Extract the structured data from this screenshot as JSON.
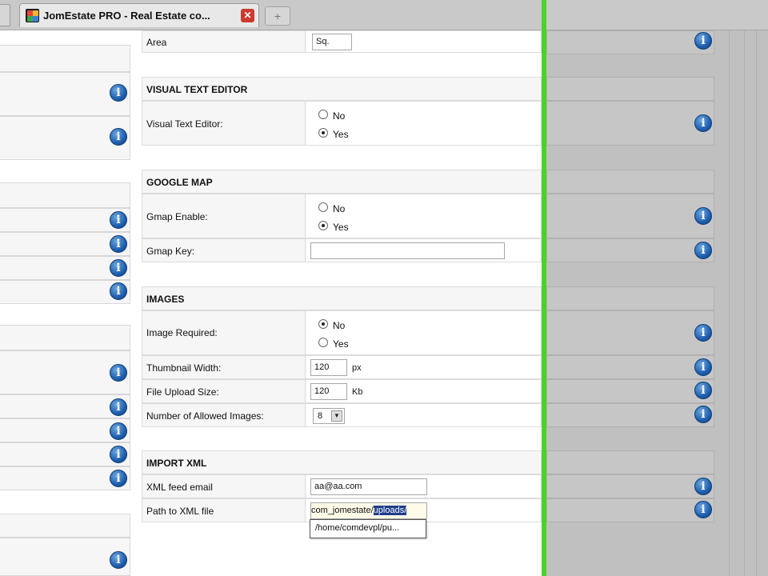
{
  "browser": {
    "tab_title": "JomEstate PRO - Real Estate co...",
    "close_symbol": "✕",
    "new_tab_symbol": "+"
  },
  "form": {
    "area": {
      "label": "Area",
      "value": "Sq."
    },
    "visual_editor": {
      "section": "VISUAL TEXT EDITOR",
      "label": "Visual Text Editor:",
      "options": [
        "No",
        "Yes"
      ],
      "selected": "Yes"
    },
    "google_map": {
      "section": "GOOGLE MAP",
      "enable_label": "Gmap Enable:",
      "options": [
        "No",
        "Yes"
      ],
      "selected": "Yes",
      "key_label": "Gmap Key:",
      "key_value": ""
    },
    "images": {
      "section": "IMAGES",
      "required_label": "Image Required:",
      "options": [
        "No",
        "Yes"
      ],
      "selected": "No",
      "thumb_label": "Thumbnail Width:",
      "thumb_value": "120",
      "thumb_unit": "px",
      "upload_label": "File Upload Size:",
      "upload_value": "120",
      "upload_unit": "Kb",
      "allowed_label": "Number of Allowed Images:",
      "allowed_value": "8"
    },
    "import_xml": {
      "section": "IMPORT XML",
      "email_label": "XML feed email",
      "email_value": "aa@aa.com",
      "path_label": "Path to XML file",
      "path_value_plain": "com_jomestate/",
      "path_value_selected": "uploads/",
      "autocomplete": "/home/comdevpl/pu..."
    }
  },
  "icons": {
    "info_glyph": "i"
  },
  "colors": {
    "accent_green": "#4ad32a",
    "info_blue": "#1e5fae",
    "close_red": "#cc3a30",
    "selection": "#1f3d8c"
  }
}
